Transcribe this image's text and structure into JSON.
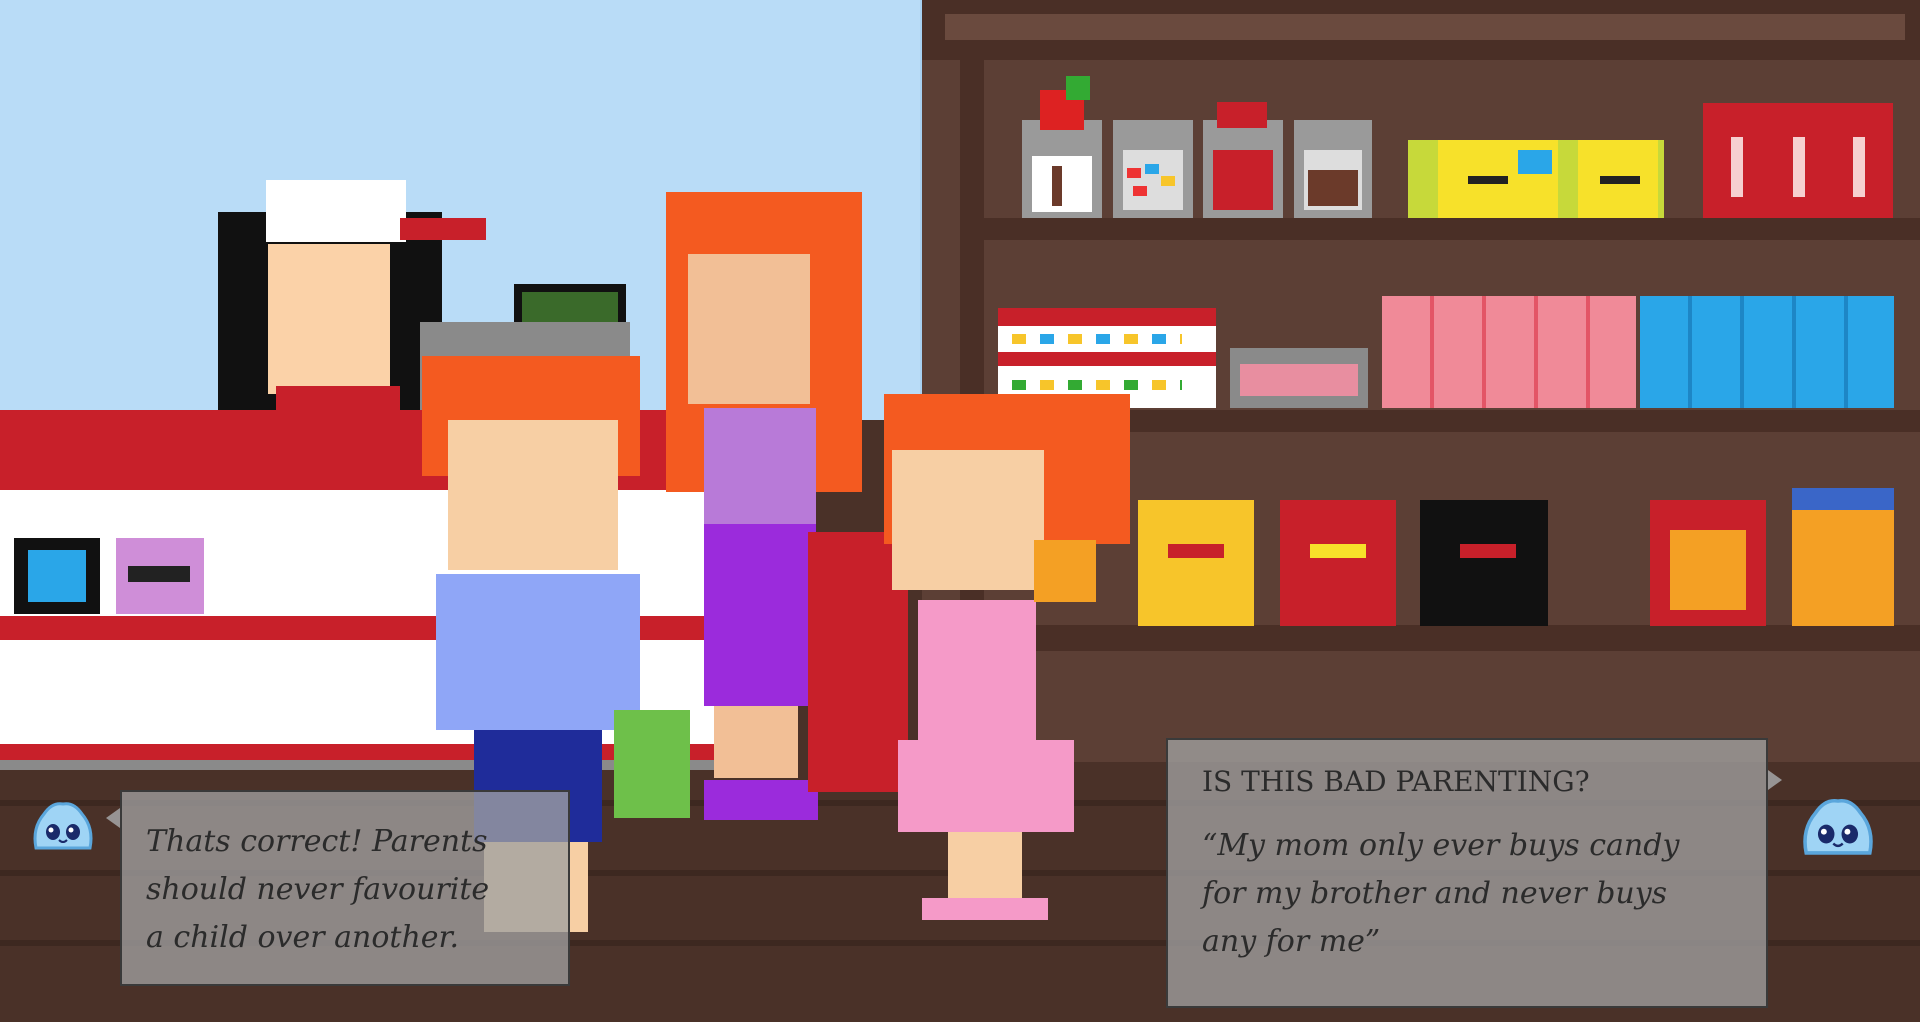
{
  "left_dialog": {
    "text": "Thats correct! Parents\nshould never favourite\na child over another."
  },
  "right_dialog": {
    "heading": "IS THIS BAD PARENTING?",
    "quote": "“My mom only ever buys candy\nfor my brother and never buys\nany for me”"
  },
  "icons": {
    "left_character": "blue-slime-icon",
    "right_character": "blue-slime-icon"
  },
  "colors": {
    "sky": "#b9dcf7",
    "shelf_wood": "#5c3f35",
    "floor": "#4a3128",
    "counter_red": "#c8202a",
    "hair_orange": "#f45a20"
  }
}
